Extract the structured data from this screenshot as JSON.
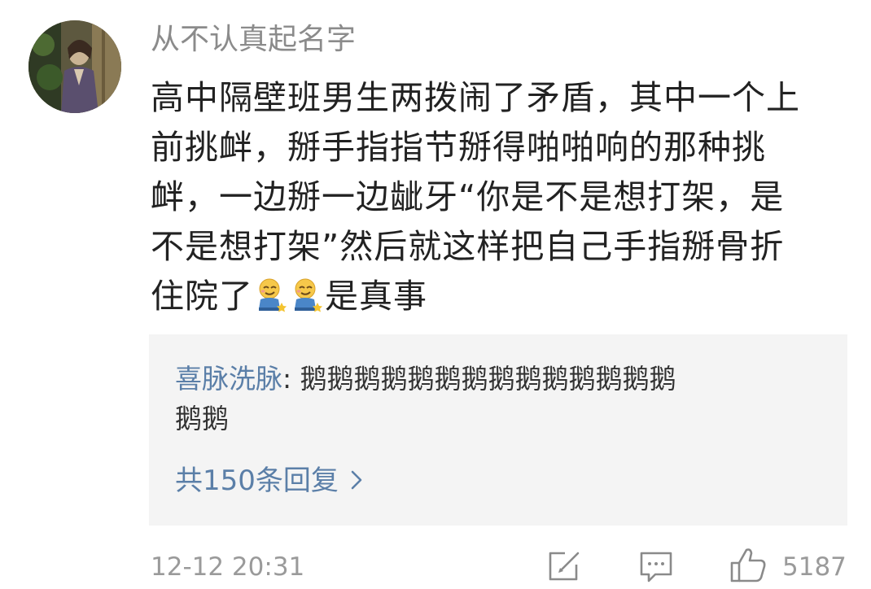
{
  "comment": {
    "username": "从不认真起名字",
    "content_lines": [
      "高中隔壁班男生两拨闹了矛盾，其中一个上",
      "前挑衅，掰手指指节掰得啪啪响的那种挑",
      "衅，一边掰一边龇牙“你是不是想打架，是",
      "不是想打架”然后就这样把自己手指掰骨折"
    ],
    "last_line_start": "住院了",
    "last_line_end": "是真事",
    "emojis": [
      "sly-grin-emoji",
      "sly-grin-emoji"
    ]
  },
  "reply": {
    "author": "喜脉洗脉",
    "separator": ": ",
    "text_line1": "鹅鹅鹅鹅鹅鹅鹅鹅鹅鹅鹅鹅鹅鹅",
    "text_line2": "鹅鹅",
    "more_label": "共150条回复"
  },
  "footer": {
    "timestamp": "12-12 20:31",
    "like_count": "5187",
    "icons": [
      "share-edit-icon",
      "comment-icon",
      "like-icon"
    ]
  },
  "colors": {
    "link": "#5b7fa8",
    "meta": "#9a9a9a",
    "text": "#222222",
    "reply_bg": "#f4f4f4"
  }
}
